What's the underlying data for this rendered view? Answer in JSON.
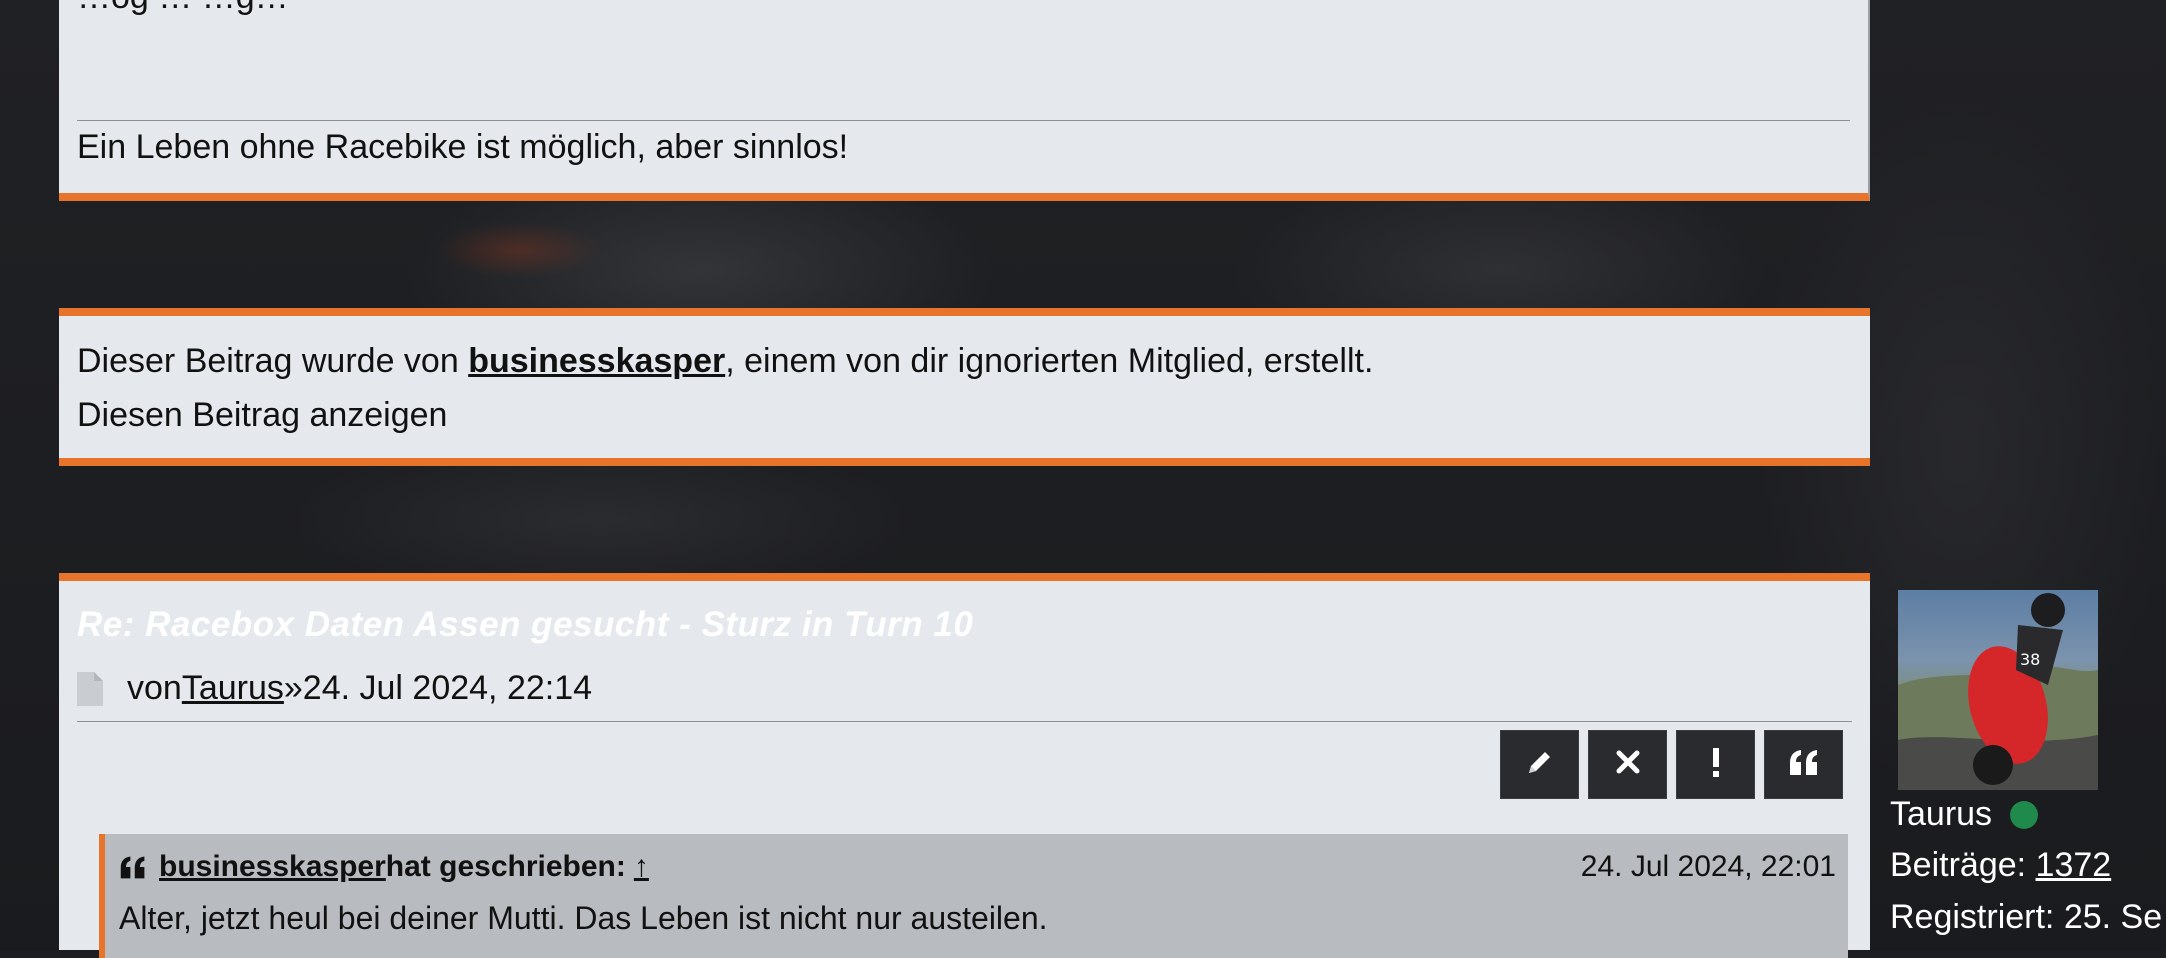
{
  "post_prev": {
    "partial_text": "…og …                                   …g…",
    "signature": "Ein Leben ohne Racebike ist möglich, aber sinnlos!"
  },
  "ignored_post": {
    "prefix": "Dieser Beitrag wurde von ",
    "user": "businesskasper",
    "suffix": ", einem von dir ignorierten Mitglied, erstellt.",
    "show_link": "Diesen Beitrag anzeigen"
  },
  "post": {
    "title": "Re: Racebox Daten Assen gesucht - Sturz in Turn 10",
    "by_label": "von ",
    "author": "Taurus",
    "date": " »24. Jul 2024, 22:14",
    "actions": [
      {
        "name": "edit-button",
        "icon": "pencil-icon"
      },
      {
        "name": "delete-button",
        "icon": "close-icon"
      },
      {
        "name": "report-button",
        "icon": "exclamation-icon"
      },
      {
        "name": "quote-button",
        "icon": "quote-icon"
      }
    ],
    "quote": {
      "user": "businesskasper",
      "wrote_label": " hat geschrieben:",
      "arrow": "↑",
      "date": "24. Jul 2024, 22:01",
      "text": "Alter, jetzt heul bei deiner Mutti. Das Leben ist nicht nur austeilen."
    }
  },
  "profile": {
    "username": "Taurus",
    "online_color": "#1f8a4c",
    "posts_label": "Beiträge: ",
    "posts_count": "1372",
    "registered": "Registriert: 25. Se"
  },
  "colors": {
    "accent": "#e8732a",
    "panel": "#e5e9ed",
    "button": "#2a2b2e"
  }
}
